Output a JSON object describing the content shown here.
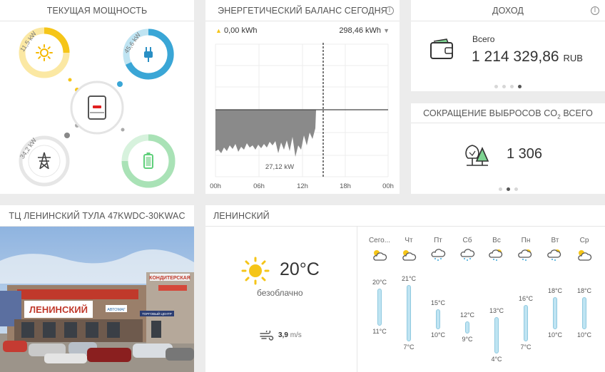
{
  "power": {
    "title": "ТЕКУЩАЯ МОЩНОСТЬ",
    "solar": "11,5 kW",
    "consumption": "45,6 kW",
    "grid": "34,2 kW"
  },
  "balance": {
    "title": "ЭНЕРГЕТИЧЕСКИЙ БАЛАНС СЕГОДНЯ",
    "up_value": "0,00 kWh",
    "down_value": "298,46 kWh",
    "marker_label": "27,12 kW",
    "x_ticks": [
      "00h",
      "06h",
      "12h",
      "18h",
      "00h"
    ]
  },
  "income": {
    "title": "ДОХОД",
    "label": "Всего",
    "amount": "1 214 329,86",
    "currency": "RUB"
  },
  "co2": {
    "title_prefix": "СОКРАЩЕНИЕ ВЫБРОСОВ CO",
    "title_sub": "2",
    "title_suffix": " ВСЕГО",
    "value": "1 306"
  },
  "site": {
    "title": "ТЦ ЛЕНИНСКИЙ ТУЛА 47KWDC-30KWAC",
    "sign_main": "ЛЕНИНСКИЙ",
    "sign_confect": "КОНДИТЕРСКАЯ",
    "sign_auto": "АВТОМАГ",
    "sign_small": "ТОРГОВЫЙ ЦЕНТР"
  },
  "weather": {
    "title": "ЛЕНИНСКИЙ",
    "temp": "20°C",
    "desc": "безоблачно",
    "wind_value": "3,9",
    "wind_unit": "m/s",
    "days": [
      {
        "name": "Сего...",
        "icon": "partly-cloudy-icon",
        "high": "20°C",
        "low": "11°C",
        "hi": 20,
        "lo": 11
      },
      {
        "name": "Чт",
        "icon": "partly-cloudy-icon",
        "high": "21°C",
        "low": "7°C",
        "hi": 21,
        "lo": 7
      },
      {
        "name": "Пт",
        "icon": "rain-cloud-icon",
        "high": "15°C",
        "low": "10°C",
        "hi": 15,
        "lo": 10
      },
      {
        "name": "Сб",
        "icon": "rain-cloud-icon",
        "high": "12°C",
        "low": "9°C",
        "hi": 12,
        "lo": 9
      },
      {
        "name": "Вс",
        "icon": "sun-rain-icon",
        "high": "13°C",
        "low": "4°C",
        "hi": 13,
        "lo": 4
      },
      {
        "name": "Пн",
        "icon": "sun-rain-icon",
        "high": "16°C",
        "low": "7°C",
        "hi": 16,
        "lo": 7
      },
      {
        "name": "Вт",
        "icon": "sun-rain-icon",
        "high": "18°C",
        "low": "10°C",
        "hi": 18,
        "lo": 10
      },
      {
        "name": "Ср",
        "icon": "partly-cloudy-icon",
        "high": "18°C",
        "low": "10°C",
        "hi": 18,
        "lo": 10
      }
    ]
  },
  "colors": {
    "solar": "#f5c518",
    "consumption": "#3aa6d6",
    "battery": "#7dd491",
    "temp_bar": "#bfe4f2"
  }
}
